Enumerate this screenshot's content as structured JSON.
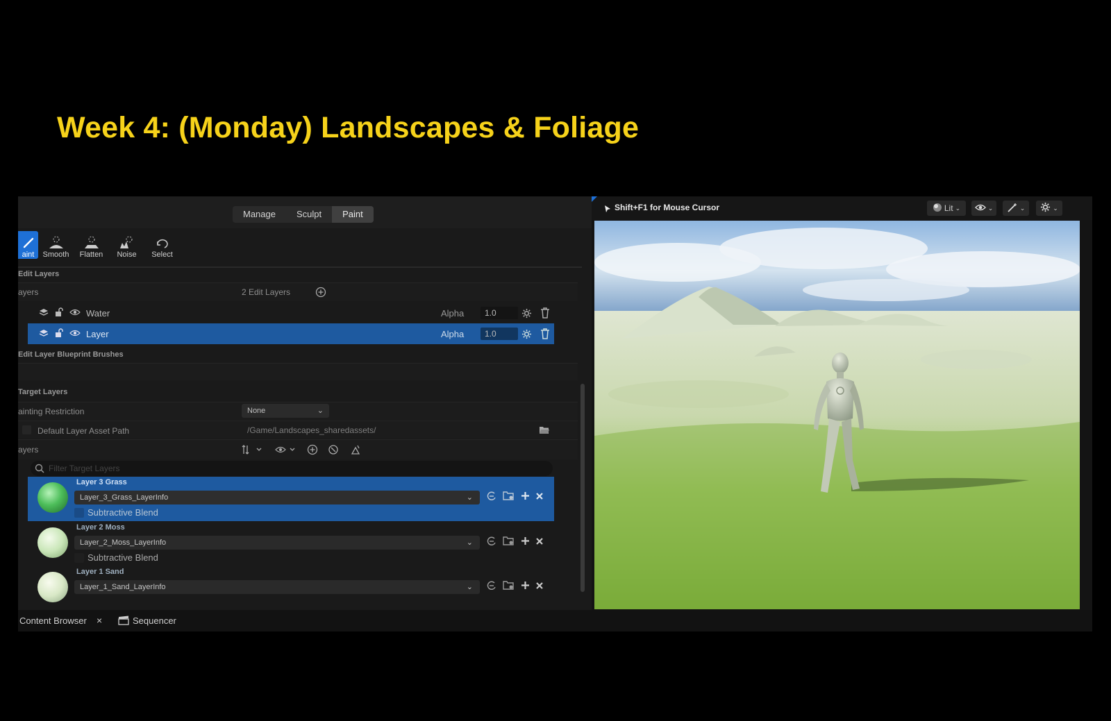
{
  "slide": {
    "title": "Week 4: (Monday) Landscapes & Foliage"
  },
  "modes": {
    "tabs": [
      "Manage",
      "Sculpt",
      "Paint"
    ],
    "active": "Paint"
  },
  "tools": [
    {
      "label": "aint",
      "icon": "paint-brush-icon"
    },
    {
      "label": "Smooth",
      "icon": "smooth-icon"
    },
    {
      "label": "Flatten",
      "icon": "flatten-icon"
    },
    {
      "label": "Noise",
      "icon": "noise-icon"
    },
    {
      "label": "Select",
      "icon": "select-icon"
    }
  ],
  "edit_layers": {
    "section_label": "Edit Layers",
    "layers_label": "ayers",
    "count_label": "2 Edit Layers",
    "rows": [
      {
        "name": "Water",
        "blend": "Alpha",
        "value": "1.0",
        "selected": false
      },
      {
        "name": "Layer",
        "blend": "Alpha",
        "value": "1.0",
        "selected": true
      }
    ]
  },
  "blueprint_brushes": {
    "section_label": "Edit Layer Blueprint Brushes"
  },
  "target_layers": {
    "section_label": "Target Layers",
    "painting_restriction_label": "ainting Restriction",
    "painting_restriction_value": "None",
    "default_path_label": "Default Layer Asset Path",
    "default_path_value": "/Game/Landscapes_sharedassets/",
    "layers_label": "ayers",
    "filter_placeholder": "Filter Target Layers",
    "items": [
      {
        "name": "Layer 3 Grass",
        "info": "Layer_3_Grass_LayerInfo",
        "checkbox_label": "Subtractive Blend",
        "selected": true
      },
      {
        "name": "Layer 2 Moss",
        "info": "Layer_2_Moss_LayerInfo",
        "checkbox_label": "Subtractive Blend",
        "selected": false
      },
      {
        "name": "Layer 1 Sand",
        "info": "Layer_1_Sand_LayerInfo",
        "selected": false
      }
    ]
  },
  "bottom_tabs": {
    "content_browser": "Content Browser",
    "close": "×",
    "sequencer": "Sequencer"
  },
  "viewport": {
    "hint": "Shift+F1 for Mouse Cursor",
    "view_mode": "Lit"
  },
  "colors": {
    "accent": "#1e70d6",
    "selection": "#1e5aa0",
    "title": "#f6d21a"
  }
}
